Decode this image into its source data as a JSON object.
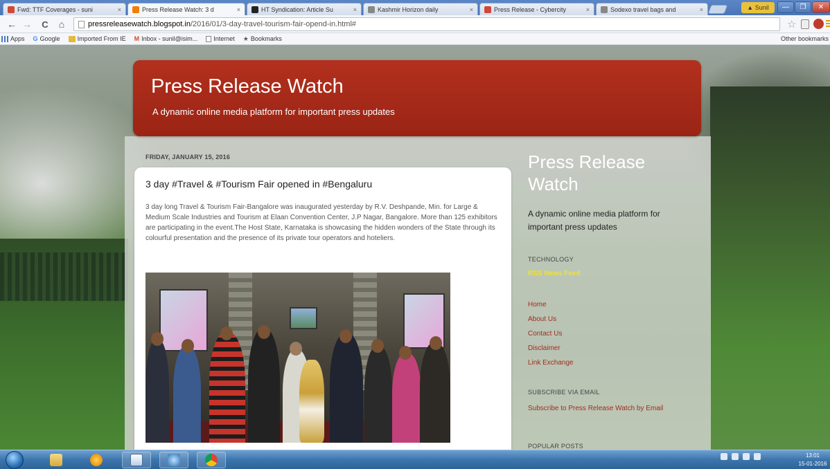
{
  "browser": {
    "tabs": [
      {
        "title": "Fwd: TTF Coverages - suni",
        "favicon_color": "#d14836",
        "active": false
      },
      {
        "title": "Press Release Watch: 3 d",
        "favicon_color": "#f57d00",
        "active": true
      },
      {
        "title": "HT Syndication: Article Su",
        "favicon_color": "#222222",
        "active": false
      },
      {
        "title": "Kashmir Horizon daily",
        "favicon_color": "#888888",
        "active": false
      },
      {
        "title": "Press Release - Cybercity",
        "favicon_color": "#d14836",
        "active": false
      },
      {
        "title": "Sodexo travel bags and",
        "favicon_color": "#888888",
        "active": false
      }
    ],
    "tab_close": "×",
    "user_badge": "▲ Sunil",
    "window_buttons": [
      "—",
      "❐",
      "✕"
    ],
    "nav": {
      "back": "←",
      "forward": "→",
      "reload": "C",
      "home": "⌂"
    },
    "url_host": "pressreleasewatch.blogspot.in",
    "url_path": "/2016/01/3-day-travel-tourism-fair-opend-in.html#",
    "star": "☆",
    "bookmarks": [
      {
        "label": "Apps",
        "icon": "apps-grid-icon"
      },
      {
        "label": "Google",
        "icon": "google-icon"
      },
      {
        "label": "Imported From IE",
        "icon": "folder-icon"
      },
      {
        "label": "Inbox - sunil@isim...",
        "icon": "gmail-icon"
      },
      {
        "label": "Internet",
        "icon": "page-icon"
      },
      {
        "label": "Bookmarks",
        "icon": "star-icon"
      }
    ],
    "other_bookmarks": "Other bookmarks"
  },
  "blog": {
    "title": "Press Release Watch",
    "description": "A dynamic online media platform for important press updates",
    "date_header": "FRIDAY, JANUARY 15, 2016",
    "post": {
      "title": "3 day #Travel & #Tourism Fair opened in #Bengaluru",
      "body": "3 day long Travel & Tourism Fair-Bangalore was inaugurated yesterday by R.V. Deshpande, Min. for Large & Medium Scale Industries and Tourism at Elaan Convention Center, J.P Nagar, Bangalore. More than 125 exhibitors are participating in the event.The Host State, Karnataka is showcasing the hidden wonders of the State through its colourful presentation and the presence of its private tour operators and hoteliers."
    },
    "sidebar": {
      "title": "Press Release Watch",
      "description": "A dynamic online media platform for important press updates",
      "technology_heading": "TECHNOLOGY",
      "rss_link": "RSS News Feed",
      "links": [
        "Home",
        "About Us",
        "Contact Us",
        "Disclaimer",
        "Link Exchange"
      ],
      "subscribe_heading": "SUBSCRIBE VIA EMAIL",
      "subscribe_link": "Subscribe to Press Release Watch by Email",
      "popular_heading": "POPULAR POSTS"
    }
  },
  "taskbar": {
    "items": [
      "explorer-icon",
      "media-player-icon",
      "notepad-icon",
      "network-icon",
      "chrome-icon"
    ],
    "clock_time": "13:01",
    "clock_date": "15-01-2016"
  },
  "colors": {
    "header_red": "#a92a18",
    "link_red": "#a42c1e",
    "rss_yellow": "#f2e030",
    "taskbar_blue": "#3c75ad"
  }
}
